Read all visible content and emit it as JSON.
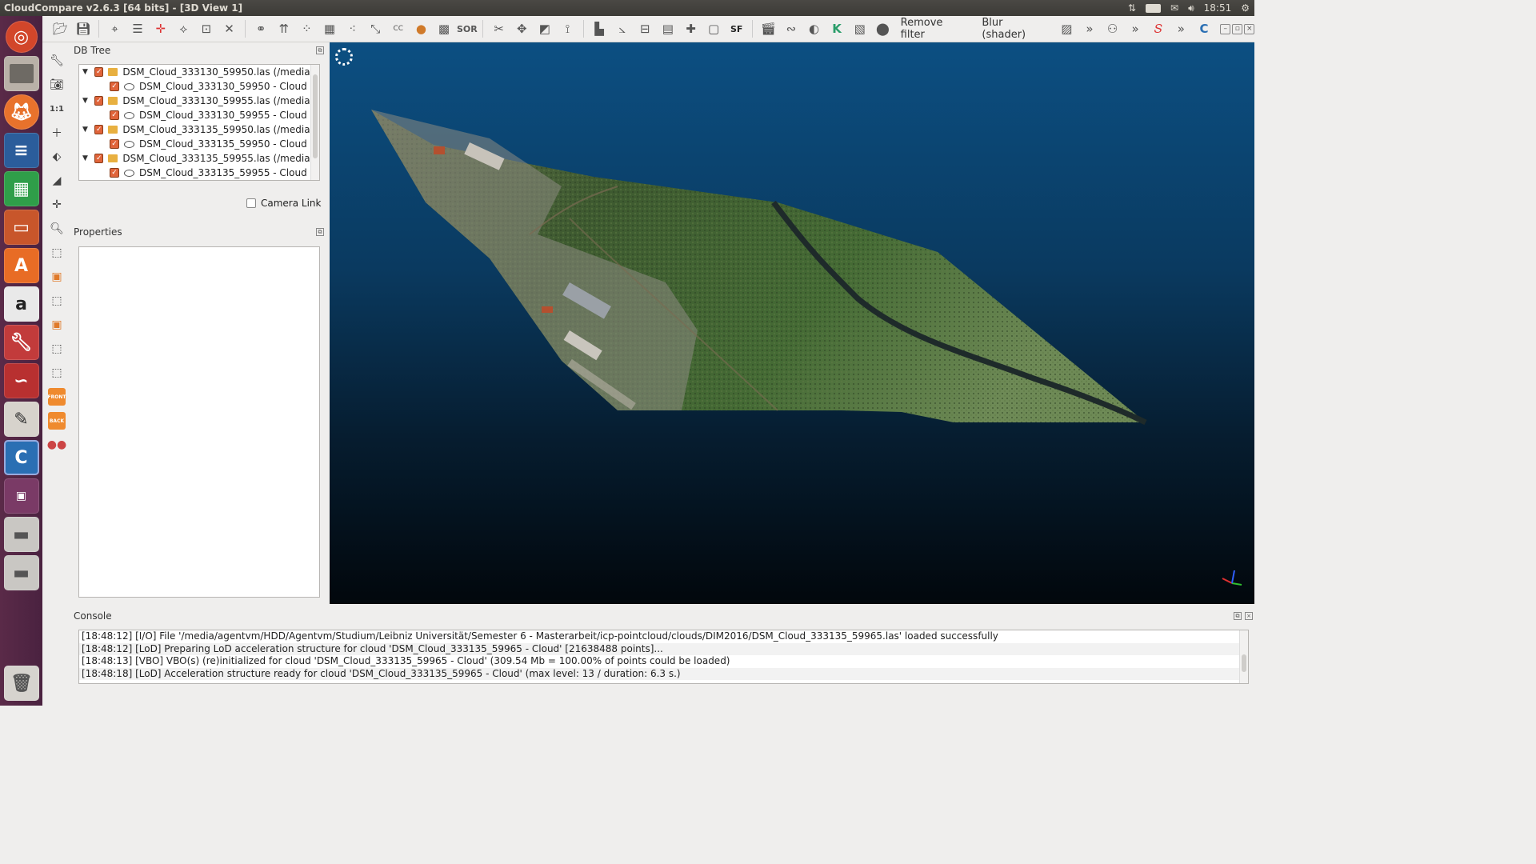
{
  "window": {
    "title": "CloudCompare v2.6.3 [64 bits] - [3D View 1]"
  },
  "system_tray": {
    "keyboard_layout": "De",
    "clock": "18:51"
  },
  "toolbar": {
    "remove_filter_label": "Remove filter",
    "blur_label": "Blur (shader)",
    "sor_label": "SOR",
    "sf_label": "SF",
    "overflow_glyph": "»"
  },
  "vstrip": {
    "scale_label": "1:1",
    "front_label": "FRONT",
    "back_label": "BACK"
  },
  "db_tree": {
    "title": "DB Tree",
    "items": [
      {
        "label": "DSM_Cloud_333130_59950.las (/media...",
        "child": "DSM_Cloud_333130_59950 - Cloud"
      },
      {
        "label": "DSM_Cloud_333130_59955.las (/media...",
        "child": "DSM_Cloud_333130_59955 - Cloud"
      },
      {
        "label": "DSM_Cloud_333135_59950.las (/media...",
        "child": "DSM_Cloud_333135_59950 - Cloud"
      },
      {
        "label": "DSM_Cloud_333135_59955.las (/media...",
        "child": "DSM_Cloud_333135_59955 - Cloud"
      }
    ]
  },
  "camera_link": {
    "label": "Camera Link",
    "checked": false
  },
  "properties": {
    "title": "Properties"
  },
  "console": {
    "title": "Console",
    "lines": [
      "[18:48:12] [I/O] File '/media/agentvm/HDD/Agentvm/Studium/Leibniz Universität/Semester 6 - Masterarbeit/icp-pointcloud/clouds/DIM2016/DSM_Cloud_333135_59965.las' loaded successfully",
      "[18:48:12] [LoD] Preparing LoD acceleration structure for cloud 'DSM_Cloud_333135_59965 - Cloud' [21638488 points]...",
      "[18:48:13] [VBO] VBO(s) (re)initialized for cloud 'DSM_Cloud_333135_59965 - Cloud' (309.54 Mb = 100.00% of points could be loaded)",
      "[18:48:18] [LoD] Acceleration structure ready for cloud 'DSM_Cloud_333135_59965 - Cloud' (max level: 13 / duration: 6.3 s.)"
    ]
  },
  "colors": {
    "launcher": "#5a2a48",
    "view_top": "#0c4f82",
    "view_bottom": "#02070c",
    "checkbox": "#e0643a"
  }
}
